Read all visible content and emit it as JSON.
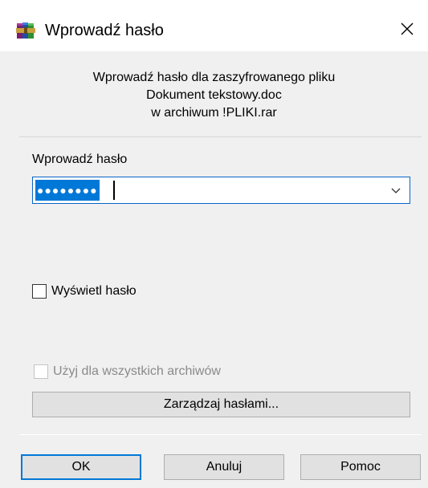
{
  "window": {
    "title": "Wprowadź hasło",
    "icon": "winrar-books-icon",
    "close_icon": "close-icon"
  },
  "info": {
    "line1": "Wprowadź hasło dla zaszyfrowanego pliku",
    "line2": "Dokument tekstowy.doc",
    "line3": "w archiwum !PLIKI.rar"
  },
  "password": {
    "label": "Wprowadź hasło",
    "value": "●●●●●●●●",
    "dropdown_icon": "chevron-down-icon"
  },
  "show_password": {
    "label": "Wyświetl hasło",
    "checked": false
  },
  "use_for_all": {
    "label": "Użyj dla wszystkich archiwów",
    "checked": false,
    "enabled": false
  },
  "buttons": {
    "manage": "Zarządzaj hasłami...",
    "ok": "OK",
    "cancel": "Anuluj",
    "help": "Pomoc"
  },
  "colors": {
    "accent": "#0078d7",
    "background": "#f0f0f0",
    "button_face": "#e1e1e1",
    "disabled_text": "#8a8a8a"
  }
}
